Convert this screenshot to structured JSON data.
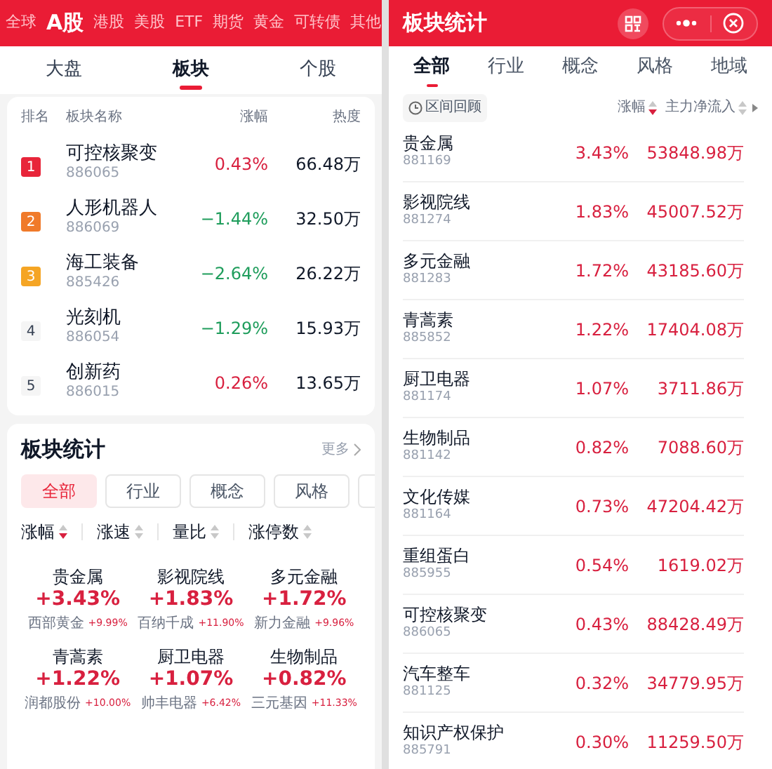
{
  "market_tabs": [
    {
      "label": "全球",
      "selected": false
    },
    {
      "label": "A股",
      "selected": true
    },
    {
      "label": "港股",
      "selected": false
    },
    {
      "label": "美股",
      "selected": false
    },
    {
      "label": "ETF",
      "selected": false
    },
    {
      "label": "期货",
      "selected": false
    },
    {
      "label": "黄金",
      "selected": false
    },
    {
      "label": "可转债",
      "selected": false
    },
    {
      "label": "其他",
      "selected": false
    }
  ],
  "view_tabs": [
    {
      "label": "大盘",
      "selected": false
    },
    {
      "label": "板块",
      "selected": true
    },
    {
      "label": "个股",
      "selected": false
    }
  ],
  "ranking": {
    "columns": [
      "排名",
      "板块名称",
      "涨幅",
      "热度"
    ],
    "rows": [
      {
        "rank": "1",
        "color": "#e8253a",
        "name": "可控核聚变",
        "code": "886065",
        "change": "0.43%",
        "rising": true,
        "heat": "66.48万"
      },
      {
        "rank": "2",
        "color": "#f07a2a",
        "name": "人形机器人",
        "code": "886069",
        "change": "−1.44%",
        "rising": false,
        "heat": "32.50万"
      },
      {
        "rank": "3",
        "color": "#f5a524",
        "name": "海工装备",
        "code": "885426",
        "change": "−2.64%",
        "rising": false,
        "heat": "26.22万"
      },
      {
        "rank": "4",
        "name": "光刻机",
        "code": "886054",
        "change": "−1.29%",
        "rising": false,
        "heat": "15.93万"
      },
      {
        "rank": "5",
        "name": "创新药",
        "code": "886015",
        "change": "0.26%",
        "rising": true,
        "heat": "13.65万"
      }
    ]
  },
  "stats_card": {
    "title": "板块统计",
    "more": "更多",
    "filters": [
      {
        "label": "全部",
        "selected": true
      },
      {
        "label": "行业",
        "selected": false
      },
      {
        "label": "概念",
        "selected": false
      },
      {
        "label": "风格",
        "selected": false
      }
    ],
    "sort_options": [
      {
        "label": "涨幅",
        "selected": true
      },
      {
        "label": "涨速",
        "selected": false
      },
      {
        "label": "量比",
        "selected": false
      },
      {
        "label": "涨停数",
        "selected": false
      }
    ],
    "tiles": [
      {
        "name": "贵金属",
        "change": "+3.43%",
        "leader": "西部黄金",
        "leader_change": "+9.99%"
      },
      {
        "name": "影视院线",
        "change": "+1.83%",
        "leader": "百纳千成",
        "leader_change": "+11.90%"
      },
      {
        "name": "多元金融",
        "change": "+1.72%",
        "leader": "新力金融",
        "leader_change": "+9.96%"
      },
      {
        "name": "青蒿素",
        "change": "+1.22%",
        "leader": "润都股份",
        "leader_change": "+10.00%"
      },
      {
        "name": "厨卫电器",
        "change": "+1.07%",
        "leader": "帅丰电器",
        "leader_change": "+6.42%"
      },
      {
        "name": "生物制品",
        "change": "+0.82%",
        "leader": "三元基因",
        "leader_change": "+11.33%"
      }
    ]
  },
  "detail": {
    "title": "板块统计",
    "tabs": [
      {
        "label": "全部",
        "selected": true
      },
      {
        "label": "行业",
        "selected": false
      },
      {
        "label": "概念",
        "selected": false
      },
      {
        "label": "风格",
        "selected": false
      },
      {
        "label": "地域",
        "selected": false
      }
    ],
    "range_button": "区间回顾",
    "columns": [
      {
        "label": "涨幅",
        "selected": true
      },
      {
        "label": "主力净流入",
        "selected": false
      }
    ],
    "rows": [
      {
        "name": "贵金属",
        "code": "881169",
        "change": "3.43%",
        "inflow": "53848.98万"
      },
      {
        "name": "影视院线",
        "code": "881274",
        "change": "1.83%",
        "inflow": "45007.52万"
      },
      {
        "name": "多元金融",
        "code": "881283",
        "change": "1.72%",
        "inflow": "43185.60万"
      },
      {
        "name": "青蒿素",
        "code": "885852",
        "change": "1.22%",
        "inflow": "17404.08万"
      },
      {
        "name": "厨卫电器",
        "code": "881174",
        "change": "1.07%",
        "inflow": "3711.86万"
      },
      {
        "name": "生物制品",
        "code": "881142",
        "change": "0.82%",
        "inflow": "7088.60万"
      },
      {
        "name": "文化传媒",
        "code": "881164",
        "change": "0.73%",
        "inflow": "47204.42万"
      },
      {
        "name": "重组蛋白",
        "code": "885955",
        "change": "0.54%",
        "inflow": "1619.02万"
      },
      {
        "name": "可控核聚变",
        "code": "886065",
        "change": "0.43%",
        "inflow": "88428.49万"
      },
      {
        "name": "汽车整车",
        "code": "881125",
        "change": "0.32%",
        "inflow": "34779.95万"
      },
      {
        "name": "知识产权保护",
        "code": "885791",
        "change": "0.30%",
        "inflow": "11259.50万"
      }
    ]
  }
}
